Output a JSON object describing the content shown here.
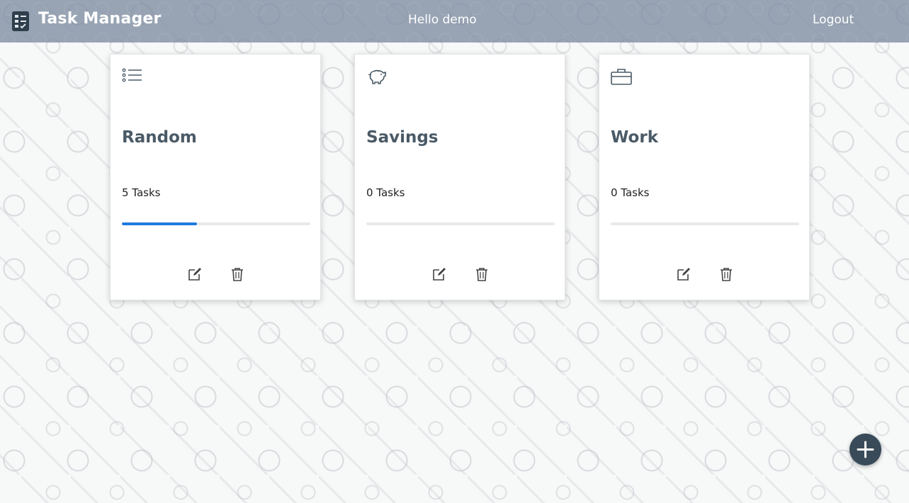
{
  "header": {
    "brand": "Task Manager",
    "greeting": "Hello demo",
    "logout_label": "Logout"
  },
  "lists": [
    {
      "title": "Random",
      "count_label": "5 Tasks",
      "icon": "list-icon",
      "progress": 0.4
    },
    {
      "title": "Savings",
      "count_label": "0 Tasks",
      "icon": "piggy-bank-icon",
      "progress": 0
    },
    {
      "title": "Work",
      "count_label": "0 Tasks",
      "icon": "briefcase-icon",
      "progress": 0
    }
  ],
  "actions": {
    "edit_icon": "edit-icon",
    "delete_icon": "trash-icon",
    "add_icon": "plus-icon"
  },
  "colors": {
    "accent": "#1e7be0",
    "fab": "#394b59",
    "title": "#4a5a66"
  }
}
